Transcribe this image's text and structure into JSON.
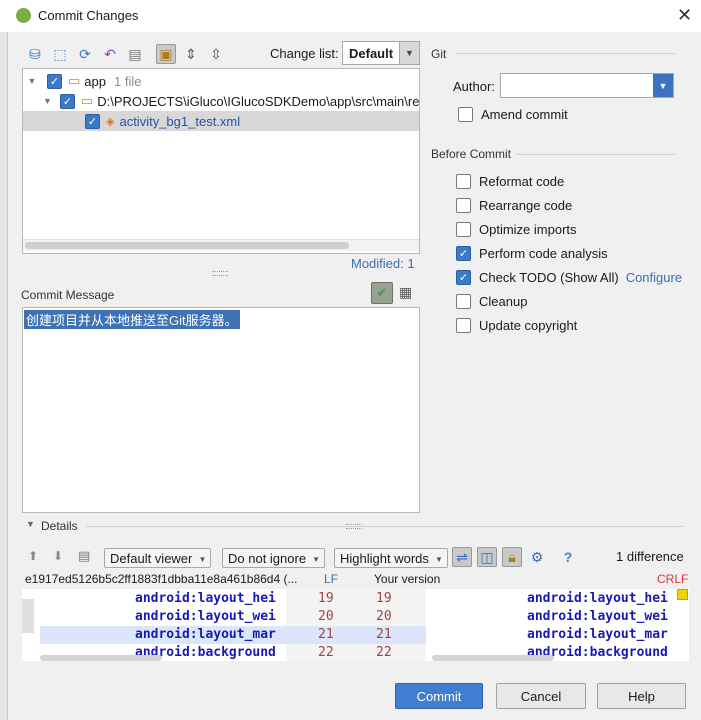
{
  "window": {
    "title": "Commit Changes"
  },
  "toolbar": {
    "icons": [
      "lock-icon",
      "refresh-icon",
      "sync-icon",
      "undo-icon",
      "diff-icon",
      "group-icon",
      "expand-icon",
      "collapse-icon"
    ],
    "change_list_label": "Change list:",
    "change_list_value": "Default"
  },
  "tree": {
    "root_label": "app",
    "root_count": "1 file",
    "path": "D:\\PROJECTS\\iGluco\\IGlucoSDKDemo\\app\\src\\main\\res",
    "file": "activity_bg1_test.xml"
  },
  "modified": "Modified: 1",
  "commit_message": {
    "label": "Commit Message",
    "text": "创建项目并从本地推送至Git服务器。"
  },
  "git": {
    "section": "Git",
    "author_label": "Author:",
    "author_value": "",
    "amend_label": "Amend commit"
  },
  "before_commit": {
    "section": "Before Commit",
    "options": [
      {
        "label": "Reformat code",
        "checked": false
      },
      {
        "label": "Rearrange code",
        "checked": false
      },
      {
        "label": "Optimize imports",
        "checked": false
      },
      {
        "label": "Perform code analysis",
        "checked": true
      },
      {
        "label": "Check TODO (Show All)",
        "checked": true,
        "link": "Configure"
      },
      {
        "label": "Cleanup",
        "checked": false
      },
      {
        "label": "Update copyright",
        "checked": false
      }
    ]
  },
  "details": {
    "label": "Details",
    "viewer": "Default viewer",
    "ignore": "Do not ignore",
    "highlight": "Highlight words",
    "difference_count": "1 difference",
    "left_header": "e1917ed5126b5c2ff1883f1dbba11e8a461b86d4 (...",
    "left_lineend": "LF",
    "right_header": "Your version",
    "right_lineend": "CRLF",
    "lines": [
      {
        "left": "android:layout_hei",
        "l": "19",
        "r": "19",
        "right": "android:layout_hei"
      },
      {
        "left": "android:layout_wei",
        "l": "20",
        "r": "20",
        "right": "android:layout_wei"
      },
      {
        "left": "android:layout_mar",
        "l": "21",
        "r": "21",
        "right": "android:layout_mar"
      },
      {
        "left": "android:background",
        "l": "22",
        "r": "22",
        "right": "android:background"
      }
    ]
  },
  "buttons": {
    "commit": "Commit",
    "cancel": "Cancel",
    "help": "Help"
  },
  "colors": {
    "accent": "#3b7ac7",
    "selection": "#3e72b4",
    "changed_line": "#dbe6fb"
  }
}
